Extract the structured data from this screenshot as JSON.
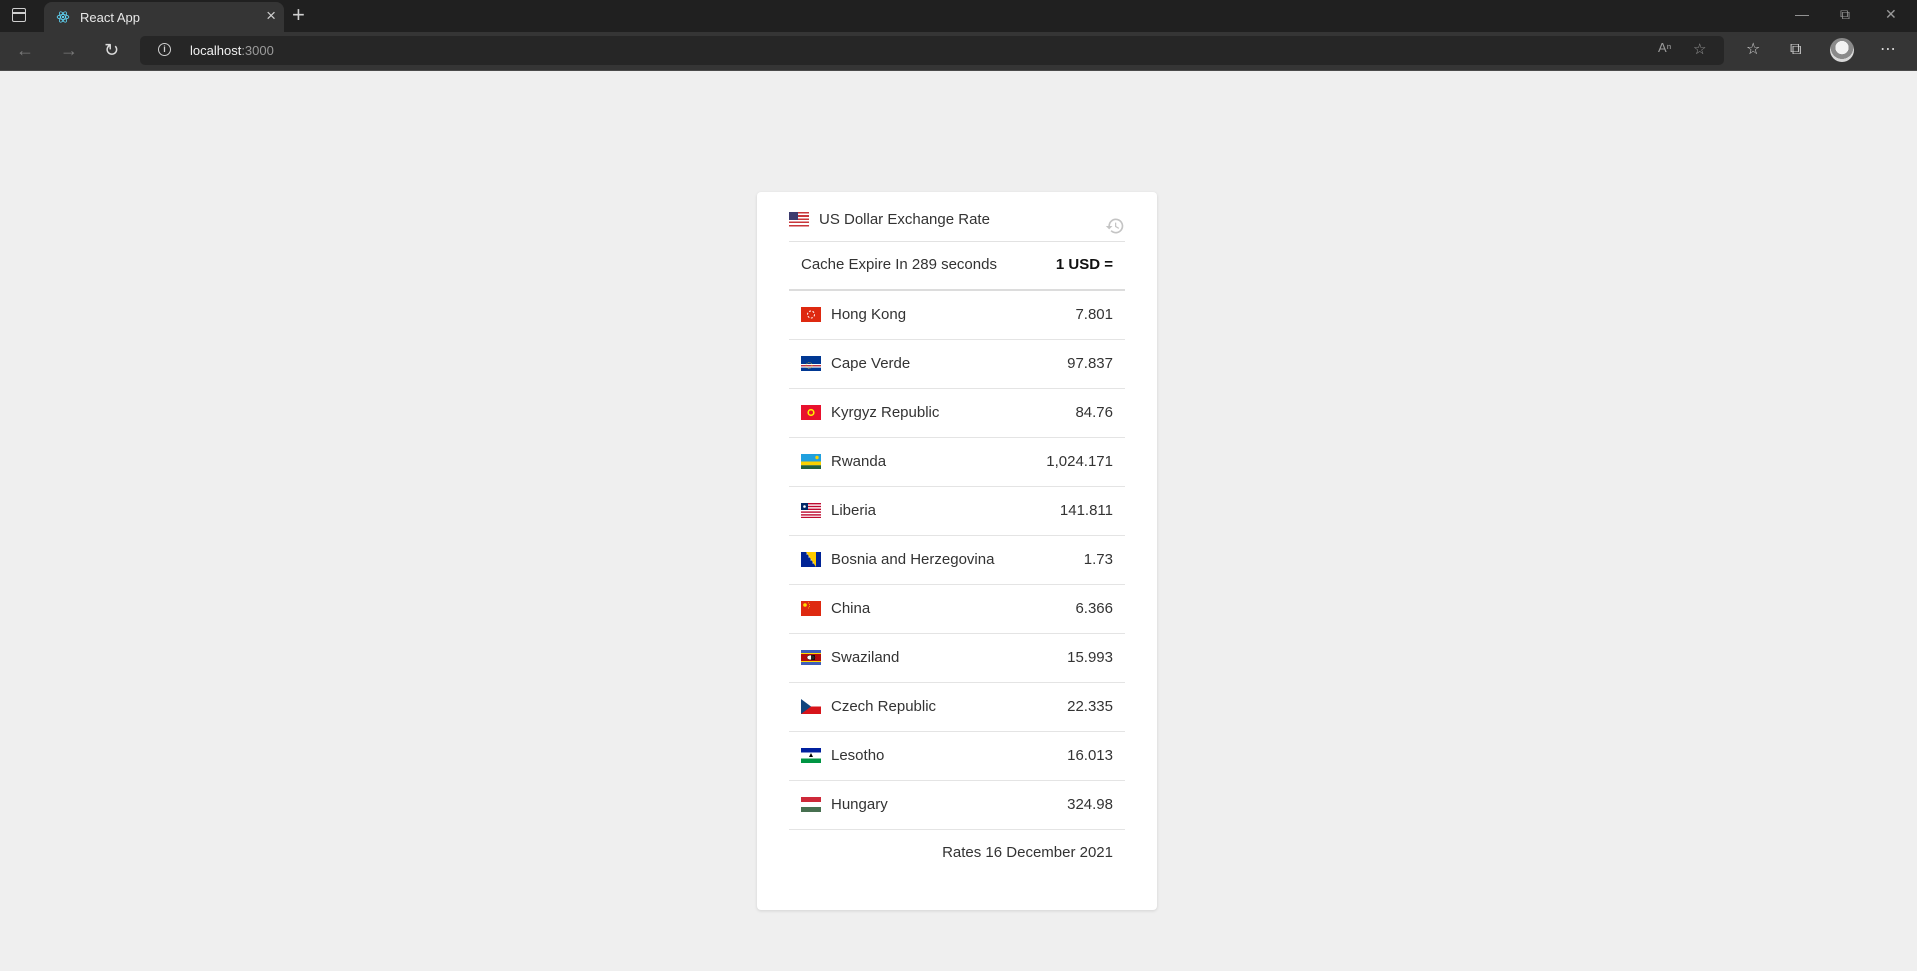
{
  "browser": {
    "tab_title": "React App",
    "tab_close": "×",
    "new_tab": "+",
    "url_host": "localhost",
    "url_port": ":3000"
  },
  "card": {
    "title": "US Dollar Exchange Rate",
    "cache_text": "Cache Expire In 289 seconds",
    "unit_text": "1 USD =",
    "footer": "Rates 16 December 2021",
    "rates": [
      {
        "country": "Hong Kong",
        "rate": "7.801",
        "flag": "hong-kong-flag"
      },
      {
        "country": "Cape Verde",
        "rate": "97.837",
        "flag": "cape-verde-flag"
      },
      {
        "country": "Kyrgyz Republic",
        "rate": "84.76",
        "flag": "kyrgyz-flag"
      },
      {
        "country": "Rwanda",
        "rate": "1,024.171",
        "flag": "rwanda-flag"
      },
      {
        "country": "Liberia",
        "rate": "141.811",
        "flag": "liberia-flag"
      },
      {
        "country": "Bosnia and Herzegovina",
        "rate": "1.73",
        "flag": "bosnia-flag"
      },
      {
        "country": "China",
        "rate": "6.366",
        "flag": "china-flag"
      },
      {
        "country": "Swaziland",
        "rate": "15.993",
        "flag": "swaziland-flag"
      },
      {
        "country": "Czech Republic",
        "rate": "22.335",
        "flag": "czech-flag"
      },
      {
        "country": "Lesotho",
        "rate": "16.013",
        "flag": "lesotho-flag"
      },
      {
        "country": "Hungary",
        "rate": "324.98",
        "flag": "hungary-flag"
      }
    ]
  },
  "colors": {
    "page_background": "#efefef",
    "card_background": "#ffffff",
    "browser_chrome": "#202020"
  }
}
